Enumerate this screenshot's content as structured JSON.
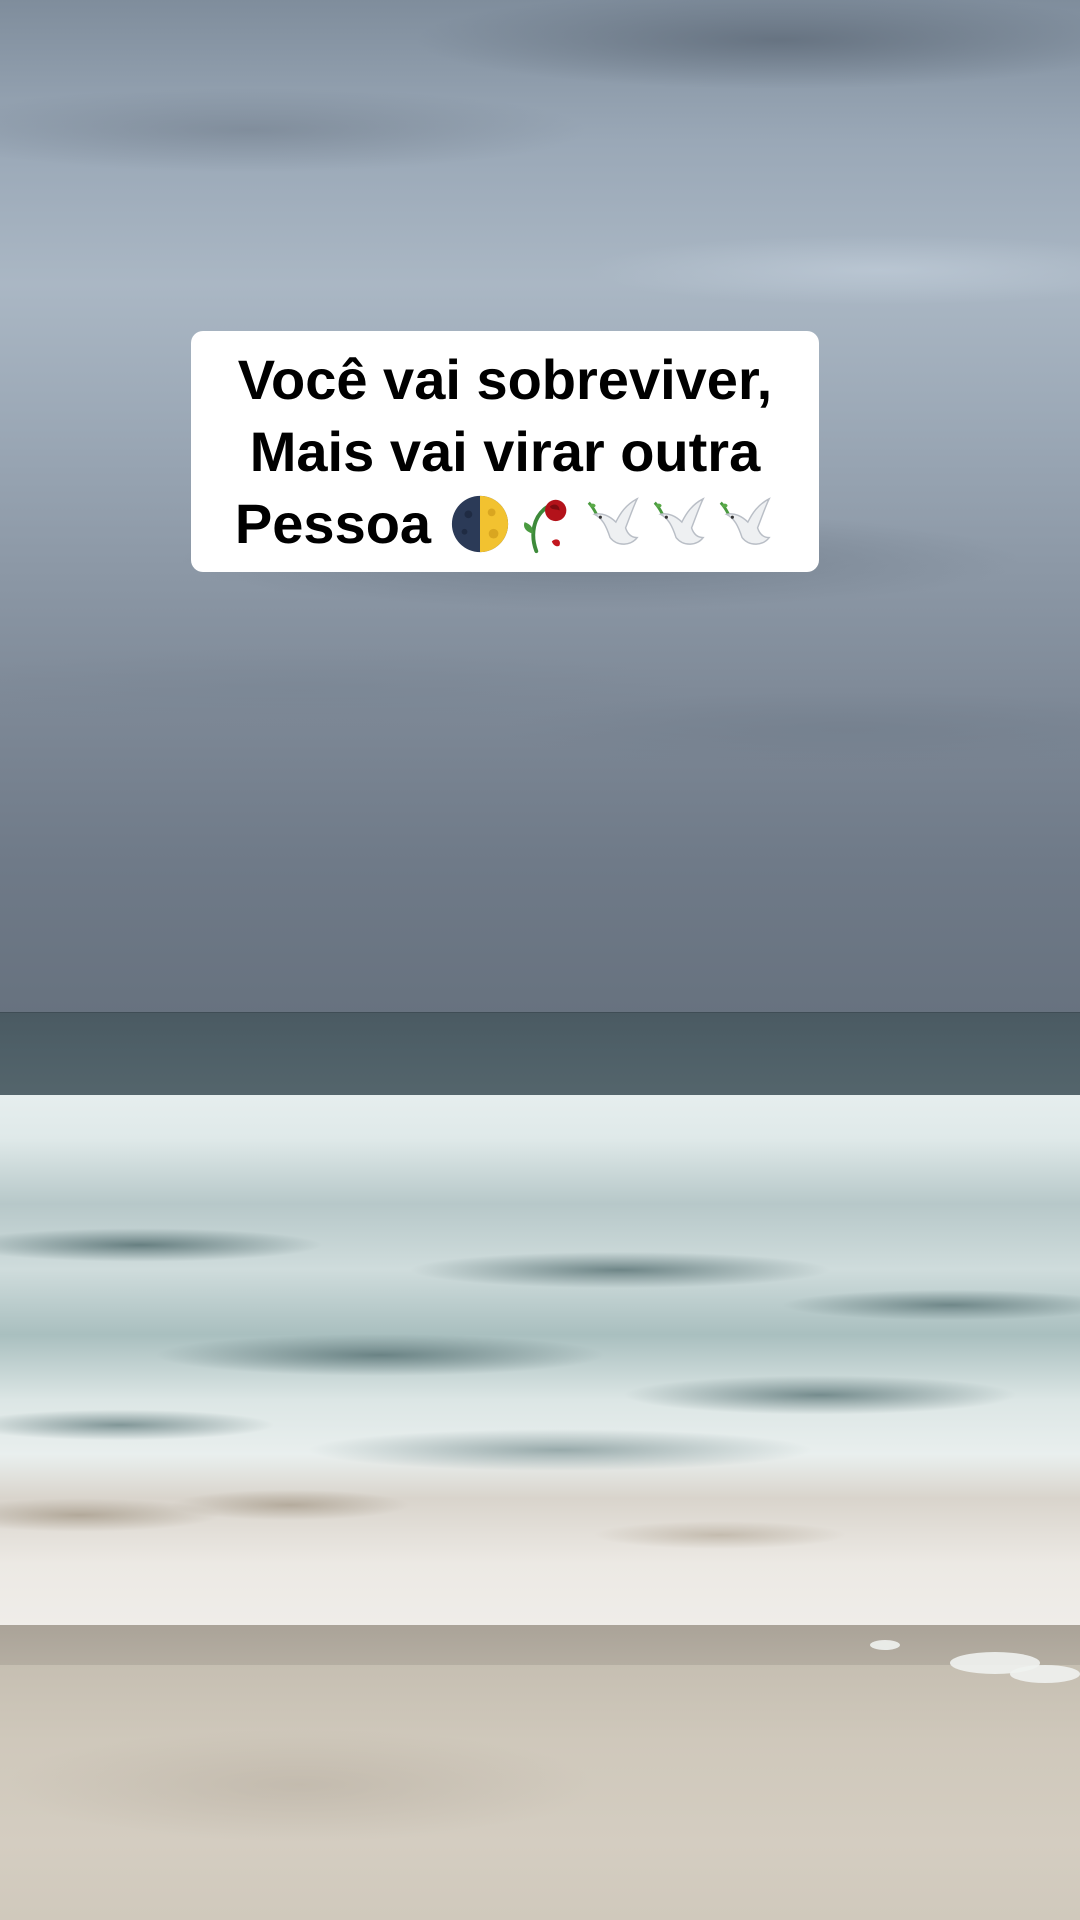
{
  "caption": {
    "line1": "Você vai sobreviver,",
    "line2": "Mais vai virar outra",
    "line3": "Pessoa"
  },
  "emojis": [
    "half-moon-icon",
    "wilted-rose-icon",
    "dove-icon",
    "dove-icon",
    "dove-icon"
  ],
  "colors": {
    "caption_background": "#ffffff",
    "caption_text": "#000000",
    "sky": "#9aa8b7",
    "sea": "#4f6068",
    "foam": "#e6eeee",
    "sand": "#cfc8bb"
  }
}
